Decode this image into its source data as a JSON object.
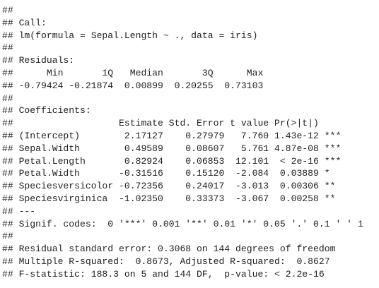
{
  "console": {
    "lines": [
      "##",
      "## Call:",
      "## lm(formula = Sepal.Length ~ ., data = iris)",
      "##",
      "## Residuals:",
      "##      Min       1Q   Median       3Q      Max",
      "## -0.79424 -0.21874  0.00899  0.20255  0.73103",
      "##",
      "## Coefficients:",
      "##                   Estimate Std. Error t value Pr(>|t|)",
      "## (Intercept)        2.17127    0.27979   7.760 1.43e-12 ***",
      "## Sepal.Width        0.49589    0.08607   5.761 4.87e-08 ***",
      "## Petal.Length       0.82924    0.06853  12.101  < 2e-16 ***",
      "## Petal.Width       -0.31516    0.15120  -2.084  0.03889 *",
      "## Speciesversicolor -0.72356    0.24017  -3.013  0.00306 **",
      "## Speciesvirginica  -1.02350    0.33373  -3.067  0.00258 **",
      "## ---",
      "## Signif. codes:  0 '***' 0.001 '**' 0.01 '*' 0.05 '.' 0.1 ' ' 1",
      "##",
      "## Residual standard error: 0.3068 on 144 degrees of freedom",
      "## Multiple R-squared:  0.8673, Adjusted R-squared:  0.8627",
      "## F-statistic: 188.3 on 5 and 144 DF,  p-value: < 2.2e-16"
    ]
  }
}
